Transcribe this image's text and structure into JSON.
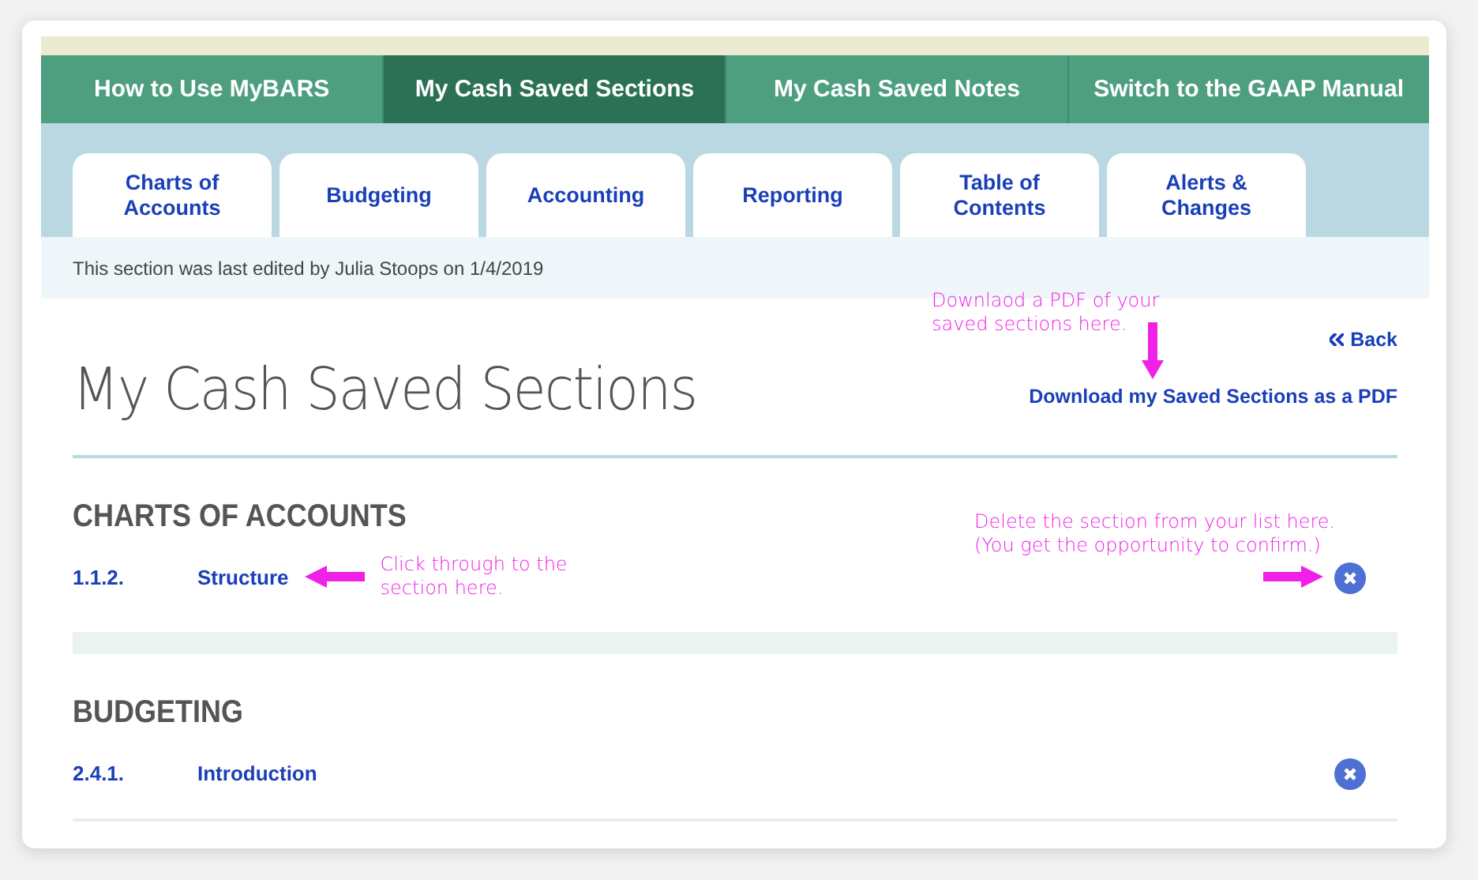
{
  "nav": [
    {
      "label": "How to Use MyBARS",
      "selected": false
    },
    {
      "label": "My Cash Saved Sections",
      "selected": true
    },
    {
      "label": "My Cash Saved Notes",
      "selected": false
    },
    {
      "label": "Switch to the GAAP Manual",
      "selected": false
    }
  ],
  "tabs": [
    {
      "label": "Charts of Accounts"
    },
    {
      "label": "Budgeting"
    },
    {
      "label": "Accounting"
    },
    {
      "label": "Reporting"
    },
    {
      "label": "Table of Contents"
    },
    {
      "label": "Alerts & Changes"
    }
  ],
  "edited_note": "This section was last edited by Julia Stoops on 1/4/2019",
  "page_title": "My Cash Saved Sections",
  "back_link": "Back",
  "download_link": "Download my Saved Sections as a PDF",
  "download_annotation": "Downlaod a PDF of your saved sections here.",
  "delete_annotation": "Delete the section from your list here. (You get the opportunity to confirm.)",
  "sections": [
    {
      "heading": "CHARTS OF ACCOUNTS",
      "items": [
        {
          "number": "1.1.2.",
          "title": "Structure",
          "annotation": "Click through to the section here."
        }
      ]
    },
    {
      "heading": "BUDGETING",
      "items": [
        {
          "number": "2.4.1.",
          "title": "Introduction"
        }
      ]
    }
  ]
}
